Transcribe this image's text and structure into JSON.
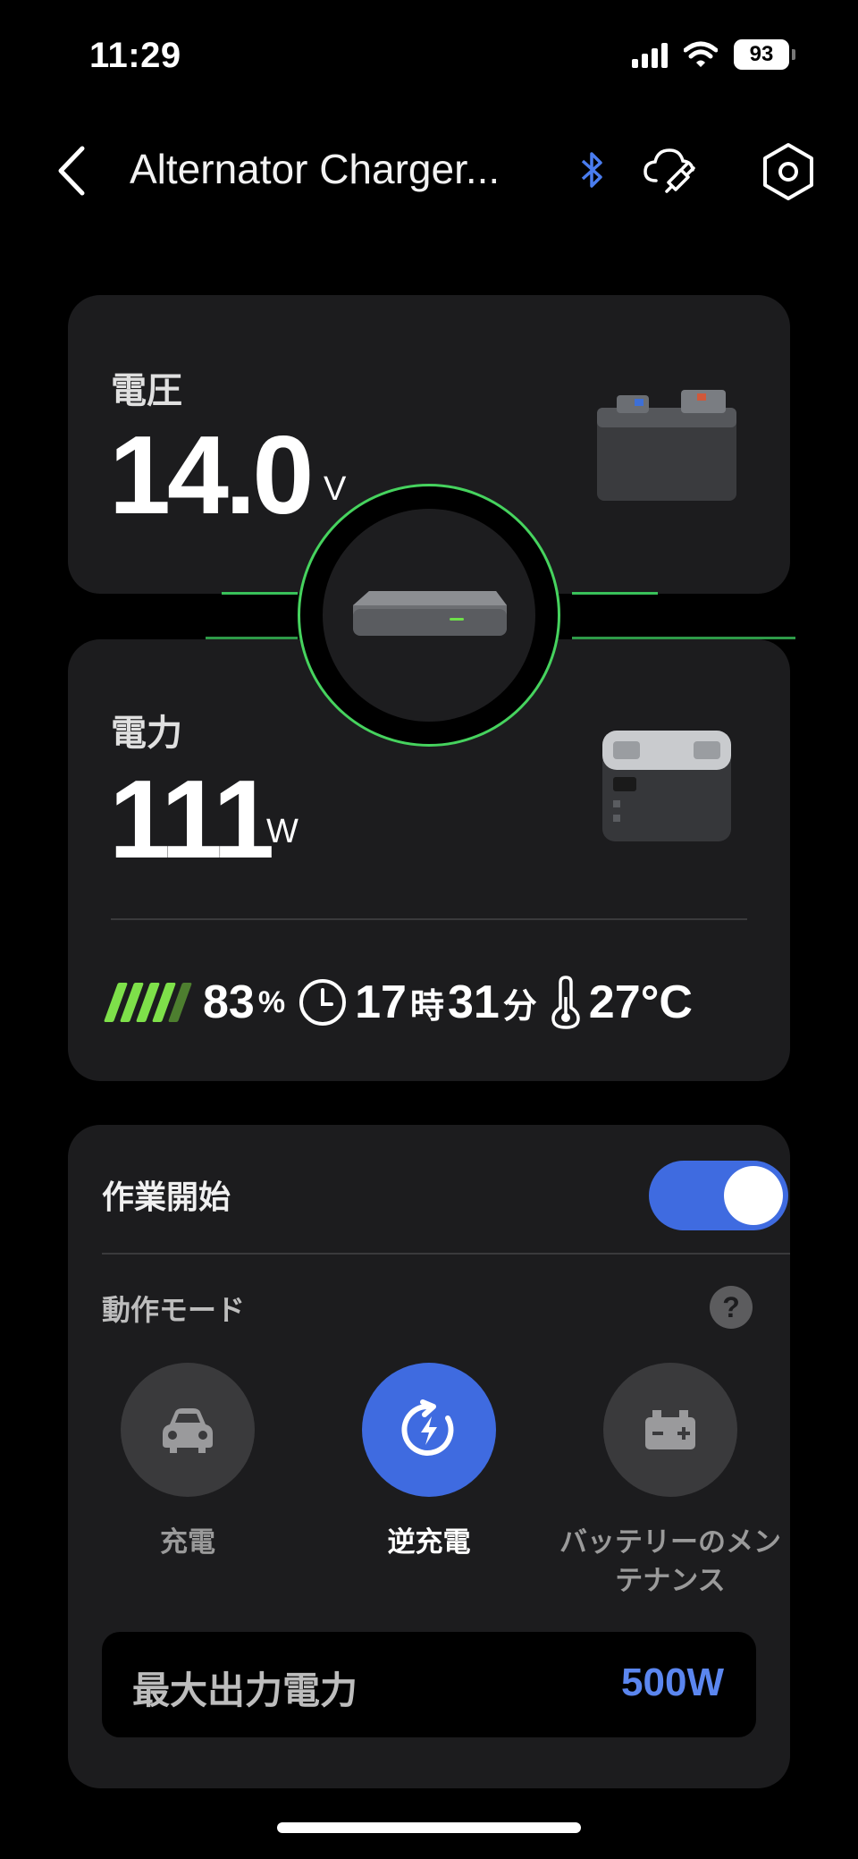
{
  "status": {
    "time": "11:29",
    "battery": "93"
  },
  "header": {
    "title": "Alternator Charger..."
  },
  "voltage": {
    "label": "電圧",
    "value": "14.0",
    "unit": "V"
  },
  "power": {
    "label": "電力",
    "value": "111",
    "unit": "W"
  },
  "stats": {
    "battery_percent": "83",
    "percent_unit": "%",
    "hours": "17",
    "hours_unit": "時",
    "minutes": "31",
    "minutes_unit": "分",
    "temperature": "27°C"
  },
  "control": {
    "switch_label": "作業開始",
    "switch_on": true,
    "mode_label": "動作モード",
    "help": "?",
    "modes": [
      {
        "label": "充電",
        "icon": "car-icon",
        "active": false
      },
      {
        "label": "逆充電",
        "icon": "reverse-charge-icon",
        "active": true
      },
      {
        "label": "バッテリーのメンテナンス",
        "icon": "car-battery-icon",
        "active": false
      }
    ],
    "max_power_label": "最大出力電力",
    "max_power_value": "500W"
  },
  "colors": {
    "accent": "#3f6be0",
    "green": "#46d35e",
    "value_blue": "#5b86ef",
    "card": "#1c1c1e"
  }
}
